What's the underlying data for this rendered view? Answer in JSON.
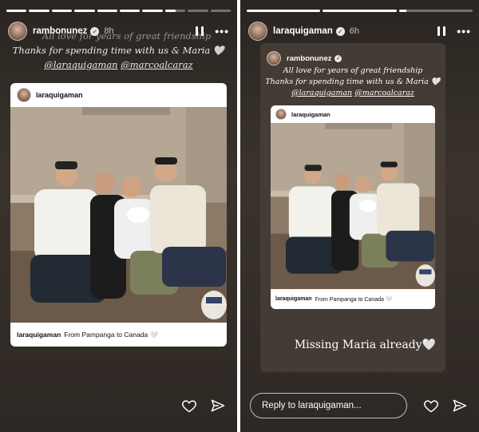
{
  "left_story": {
    "progress": [
      1,
      1,
      1,
      1,
      1,
      1,
      1,
      0.5,
      0,
      0
    ],
    "username": "rambonunez",
    "time": "8h",
    "caption_lines": [
      "All love for years of great friendship",
      "Thanks for spending time with us & Maria 🤍"
    ],
    "mentions": [
      "@laraquigaman",
      "@marcoalcaraz"
    ],
    "post": {
      "username": "laraquigaman",
      "caption_user": "laraquigaman",
      "caption_text": "From Pampanga to Canada 🤍"
    }
  },
  "right_story": {
    "progress": [
      1,
      1,
      0.1
    ],
    "username": "laraquigaman",
    "time": "6h",
    "shared": {
      "username": "rambonunez",
      "caption_lines": [
        "All love for years of great friendship",
        "Thanks for spending time with us & Maria 🤍"
      ],
      "mentions": [
        "@laraquigaman",
        "@marcoalcaraz"
      ],
      "post": {
        "username": "laraquigaman",
        "caption_user": "laraquigaman",
        "caption_text": "From Pampanga to Canada 🤍"
      }
    },
    "overlay_text": "Missing Maria already🤍",
    "reply_placeholder": "Reply to laraquigaman..."
  },
  "icons": {
    "verified": "verified-badge-icon",
    "pause": "pause-icon",
    "more": "more-options-icon",
    "like": "heart-icon",
    "share": "send-icon"
  },
  "colors": {
    "story_bg": "#2e2824",
    "card_bg": "#ffffff",
    "text": "#ffffff"
  }
}
